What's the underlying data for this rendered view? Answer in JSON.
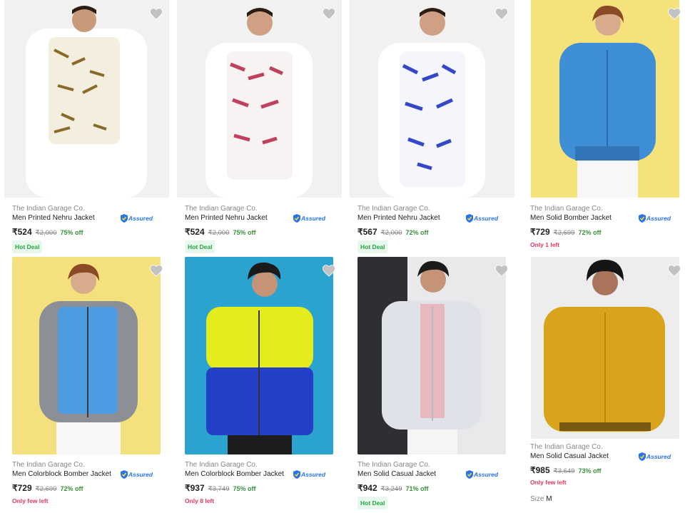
{
  "colors": {
    "assured_blue": "#2874f0",
    "discount_green": "#388e3c",
    "hot_deal_bg": "#e7f8ec",
    "stock_red": "#e5375f"
  },
  "products": [
    {
      "brand": "The Indian Garage Co.",
      "title": "Men Printed Nehru Jacket",
      "assured": "Assured",
      "price": "₹524",
      "mrp": "₹2,000",
      "off": "75% off",
      "badge": "Hot Deal",
      "icon": "heart-icon"
    },
    {
      "brand": "The Indian Garage Co.",
      "title": "Men Printed Nehru Jacket",
      "assured": "Assured",
      "price": "₹524",
      "mrp": "₹2,000",
      "off": "75% off",
      "badge": "Hot Deal",
      "icon": "heart-icon"
    },
    {
      "brand": "The Indian Garage Co.",
      "title": "Men Printed Nehru Jacket",
      "assured": "Assured",
      "price": "₹567",
      "mrp": "₹2,000",
      "off": "72% off",
      "badge": "Hot Deal",
      "icon": "heart-icon"
    },
    {
      "brand": "The Indian Garage Co.",
      "title": "Men Solid Bomber Jacket",
      "assured": "Assured",
      "price": "₹729",
      "mrp": "₹2,699",
      "off": "72% off",
      "stock": "Only 1 left",
      "icon": "heart-icon"
    },
    {
      "brand": "The Indian Garage Co.",
      "title": "Men Colorblock Bomber Jacket",
      "assured": "Assured",
      "price": "₹729",
      "mrp": "₹2,699",
      "off": "72% off",
      "stock": "Only few left",
      "icon": "heart-icon"
    },
    {
      "brand": "The Indian Garage Co.",
      "title": "Men Colorblock Bomber Jacket",
      "assured": "Assured",
      "price": "₹937",
      "mrp": "₹3,749",
      "off": "75% off",
      "stock": "Only 8 left",
      "icon": "heart-icon"
    },
    {
      "brand": "The Indian Garage Co.",
      "title": "Men Solid Casual Jacket",
      "assured": "Assured",
      "price": "₹942",
      "mrp": "₹3,249",
      "off": "71% off",
      "badge": "Hot Deal",
      "icon": "heart-icon"
    },
    {
      "brand": "The Indian Garage Co.",
      "title": "Men Solid Casual Jacket",
      "assured": "Assured",
      "price": "₹985",
      "mrp": "₹3,649",
      "off": "73% off",
      "stock": "Only few left",
      "size_label": "Size",
      "size_value": "M",
      "icon": "heart-icon"
    }
  ]
}
